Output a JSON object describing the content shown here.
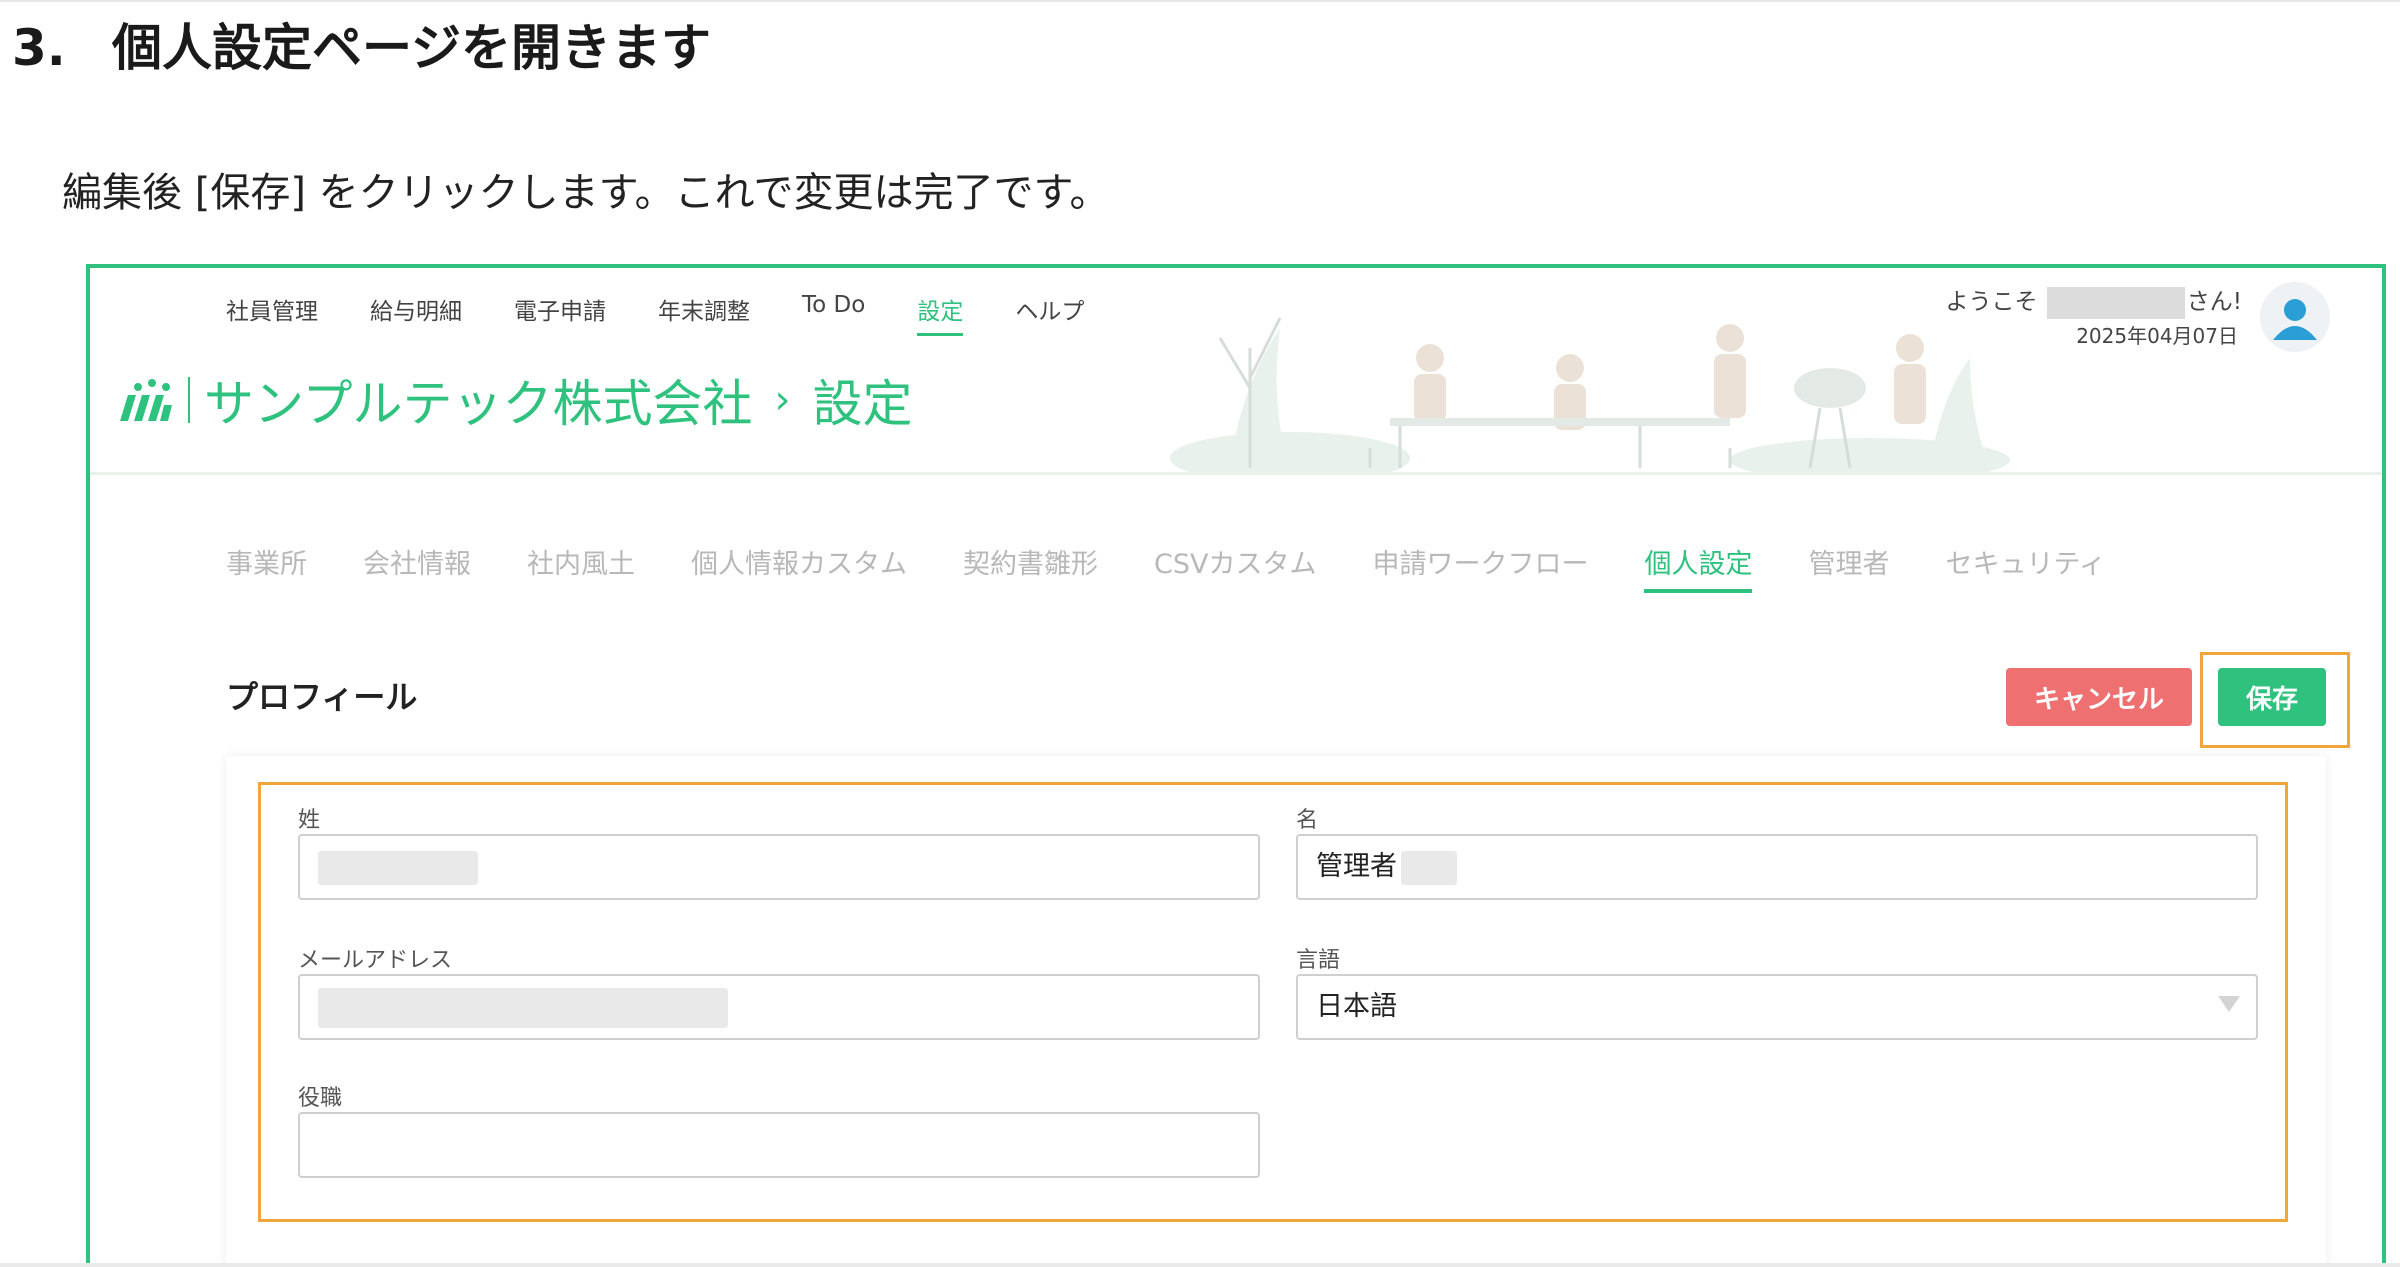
{
  "doc": {
    "step_number": "3.",
    "step_title": "個人設定ページを開きます",
    "instruction": "編集後 [保存] をクリックします。これで変更は完了です。"
  },
  "app": {
    "nav": [
      "社員管理",
      "給与明細",
      "電子申請",
      "年末調整",
      "To Do",
      "設定",
      "ヘルプ"
    ],
    "nav_active": "設定",
    "company": "サンプルテック株式会社",
    "breadcrumb_sep": "›",
    "page": "設定",
    "welcome_prefix": "ようこそ",
    "welcome_suffix": "さん!",
    "date": "2025年04月07日",
    "subtabs": [
      "事業所",
      "会社情報",
      "社内風土",
      "個人情報カスタム",
      "契約書雛形",
      "CSVカスタム",
      "申請ワークフロー",
      "個人設定",
      "管理者",
      "セキュリティ"
    ],
    "subtab_active": "個人設定",
    "section_title": "プロフィール",
    "cancel_label": "キャンセル",
    "save_label": "保存",
    "form": {
      "last_name_label": "姓",
      "first_name_label": "名",
      "first_name_value": "管理者",
      "email_label": "メールアドレス",
      "language_label": "言語",
      "language_value": "日本語",
      "role_label": "役職",
      "role_value": ""
    }
  },
  "colors": {
    "accent": "#2ec27e",
    "cancel": "#ee7070",
    "highlight": "#f0a63c"
  }
}
